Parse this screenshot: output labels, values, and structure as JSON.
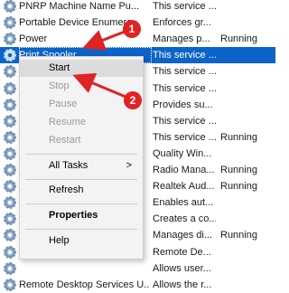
{
  "services": [
    {
      "name": "PNRP Machine Name Pu...",
      "desc": "This service ...",
      "status": ""
    },
    {
      "name": "Portable Device Enumera...",
      "desc": "Enforces gr...",
      "status": ""
    },
    {
      "name": "Power",
      "desc": "Manages p...",
      "status": "Running"
    },
    {
      "name": "Print Spooler",
      "desc": "This service ...",
      "status": "",
      "selected": true
    },
    {
      "name": "",
      "desc": "This service ...",
      "status": ""
    },
    {
      "name": "",
      "desc": "This service ...",
      "status": ""
    },
    {
      "name": "",
      "desc": "Provides su...",
      "status": ""
    },
    {
      "name": "",
      "desc": "This service ...",
      "status": ""
    },
    {
      "name": "",
      "desc": "This service ...",
      "status": "Running"
    },
    {
      "name": "",
      "desc": "Quality Win...",
      "status": ""
    },
    {
      "name": "",
      "desc": "Radio Mana...",
      "status": "Running"
    },
    {
      "name": "",
      "desc": "Realtek Aud...",
      "status": "Running"
    },
    {
      "name": "",
      "desc": "Enables aut...",
      "status": ""
    },
    {
      "name": "",
      "desc": "Creates a co...",
      "status": ""
    },
    {
      "name": "",
      "desc": "Manages di...",
      "status": "Running"
    },
    {
      "name": "",
      "desc": "Remote De...",
      "status": ""
    },
    {
      "name": "",
      "desc": "Allows user...",
      "status": ""
    },
    {
      "name": "Remote Desktop Services U...",
      "desc": "Allows the r...",
      "status": ""
    }
  ],
  "context_menu": {
    "start": "Start",
    "stop": "Stop",
    "pause": "Pause",
    "resume": "Resume",
    "restart": "Restart",
    "all_tasks": "All Tasks",
    "all_tasks_chevron": ">",
    "refresh": "Refresh",
    "properties": "Properties",
    "help": "Help"
  },
  "annotations": {
    "badge_1": "1",
    "badge_2": "2",
    "color": "#e02323"
  }
}
